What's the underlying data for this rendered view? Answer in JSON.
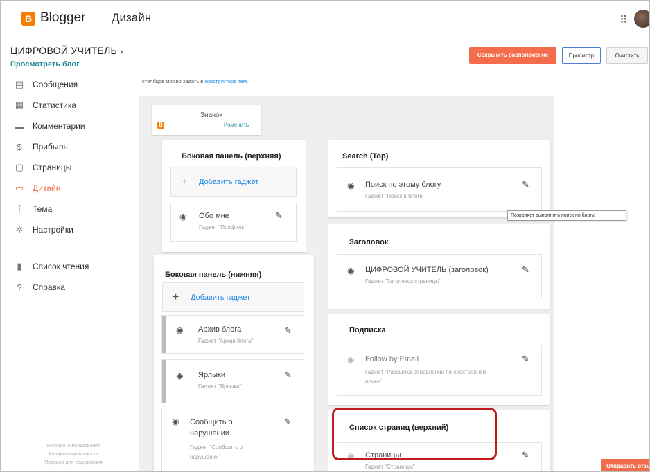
{
  "header": {
    "logo_letter": "B",
    "brand": "Blogger",
    "section": "Дизайн",
    "apps_icon": "⠿"
  },
  "blog": {
    "title": "ЦИФРОВОЙ УЧИТЕЛЬ",
    "caret": "▾",
    "view_link": "Просмотреть блог"
  },
  "toolbar": {
    "save_label": "Сохранить расположение",
    "preview_label": "Просмотр",
    "clear_label": "Очистить"
  },
  "sidebar": {
    "items": [
      {
        "label": "Сообщения",
        "icon": "posts-icon",
        "glyph": "▤"
      },
      {
        "label": "Статистика",
        "icon": "stats-icon",
        "glyph": "▦"
      },
      {
        "label": "Комментарии",
        "icon": "comments-icon",
        "glyph": "▬"
      },
      {
        "label": "Прибыль",
        "icon": "earnings-icon",
        "glyph": "$"
      },
      {
        "label": "Страницы",
        "icon": "pages-icon",
        "glyph": "▢"
      },
      {
        "label": "Дизайн",
        "icon": "layout-icon",
        "glyph": "▭"
      },
      {
        "label": "Тема",
        "icon": "theme-icon",
        "glyph": "⍑"
      },
      {
        "label": "Настройки",
        "icon": "settings-icon",
        "glyph": "✲"
      }
    ],
    "secondary": [
      {
        "label": "Список чтения",
        "icon": "reading-list-icon",
        "glyph": "▮"
      },
      {
        "label": "Справка",
        "icon": "help-icon",
        "glyph": "?"
      }
    ],
    "footer": [
      "Условия использования",
      "Конфиденциальность",
      "Правила для содержания"
    ]
  },
  "intro": {
    "line1": "…",
    "line2_text": "столбцов можно задать в",
    "line2_link": "конструкторе тем."
  },
  "favicon_card": {
    "title": "Значок",
    "edit": "Изменить"
  },
  "left_top": {
    "title": "Боковая панель (верхняя)",
    "add": "Добавить гаджет",
    "gadgets": [
      {
        "name": "Обо мне",
        "sub": "Гаджет \"Профиль\""
      }
    ]
  },
  "left_bottom": {
    "title": "Боковая панель (нижняя)",
    "add": "Добавить гаджет",
    "gadgets": [
      {
        "name": "Архив блога",
        "sub": "Гаджет \"Архив блога\""
      },
      {
        "name": "Ярлыки",
        "sub": "Гаджет \"Ярлыки\""
      },
      {
        "name": "Сообщить о нарушении",
        "sub": "Гаджет \"Сообщить о нарушении\""
      }
    ]
  },
  "right": {
    "search": {
      "title": "Search (Top)",
      "name": "Поиск по этому блогу",
      "sub": "Гаджет \"Поиск в блоге\""
    },
    "header": {
      "title": "Заголовок",
      "name": "ЦИФРОВОЙ УЧИТЕЛЬ (заголовок)",
      "sub": "Гаджет \"Заголовок страницы\""
    },
    "subscribe": {
      "title": "Подписка",
      "name": "Follow by Email",
      "sub": "Гаджет \"Рассылка обновлений по электронной почте\""
    },
    "pages": {
      "title": "Список страниц (верхний)",
      "name": "Страницы",
      "sub": "Гаджет \"Страницы\""
    }
  },
  "tooltip": "Позволяет выполнять поиск по блогу.",
  "send_feedback": "Отправить отзыв",
  "colors": {
    "accent": "#f36c4c",
    "link": "#1e88e5",
    "highlight": "#c0191f"
  }
}
